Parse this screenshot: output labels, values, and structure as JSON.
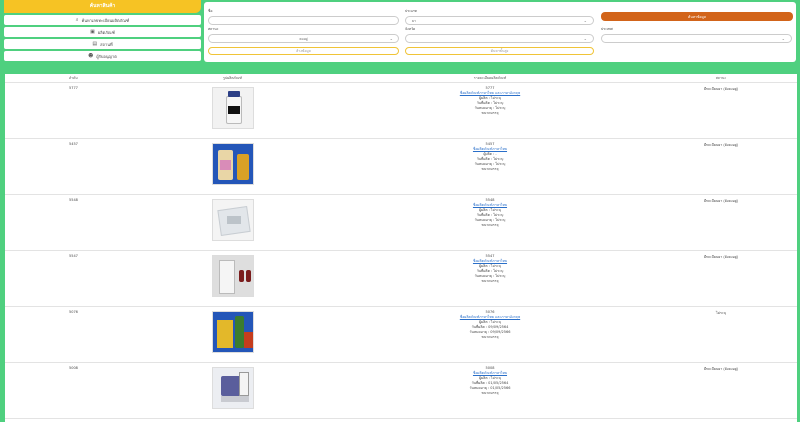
{
  "sidebar": {
    "header": "ค้นหาสินค้า",
    "items": [
      {
        "label": "ค้นหาเลขทะเบียนผลิตภัณฑ์",
        "icon": "search-icon"
      },
      {
        "label": "ผลิตภัณฑ์",
        "icon": "box-icon"
      },
      {
        "label": "สถานที่",
        "icon": "building-icon"
      },
      {
        "label": "ผู้รับอนุญาต",
        "icon": "user-icon"
      }
    ]
  },
  "search": {
    "name_label": "ชื่อ",
    "name_value": "",
    "type_label": "ประเภท",
    "type_value": "ยา",
    "search_button": "ค้นหาข้อมูล",
    "status_label": "สถานะ",
    "status_value": "คงอยู่",
    "province_label": "จังหวัด",
    "province_value": "",
    "country_label": "ประเทศ",
    "country_value": "",
    "clear_button": "ล้างข้อมูล",
    "advanced_button": "ค้นหาขั้นสูง"
  },
  "table": {
    "headers": [
      "ลำดับ",
      "รูปผลิตภัณฑ์",
      "รายละเอียดผลิตภัณฑ์",
      "สถานะ"
    ],
    "rows": [
      {
        "id": "5777",
        "code": "5777",
        "name": "ชื่อผลิตภัณฑ์ภาษาไทย และภาษาอังกฤษ",
        "line1": "ผู้ผลิต : ไม่ระบุ",
        "line2": "วันที่ผลิต : ไม่ระบุ",
        "line3": "วันหมดอายุ : ไม่ระบุ",
        "line4": "ขนาดบรรจุ",
        "status": "มีทะเบียนยา (ยังคงอยู่)"
      },
      {
        "id": "5457",
        "code": "5457",
        "name": "ชื่อผลิตภัณฑ์ภาษาไทย",
        "line1": "ผู้ผลิต : -",
        "line2": "วันที่ผลิต : ไม่ระบุ",
        "line3": "วันหมดอายุ : ไม่ระบุ",
        "line4": "ขนาดบรรจุ",
        "status": "มีทะเบียนยา (ยังคงอยู่)"
      },
      {
        "id": "5548",
        "code": "5548",
        "name": "ชื่อผลิตภัณฑ์ภาษาไทย",
        "line1": "ผู้ผลิต : ไม่ระบุ",
        "line2": "วันที่ผลิต : ไม่ระบุ",
        "line3": "วันหมดอายุ : ไม่ระบุ",
        "line4": "ขนาดบรรจุ",
        "status": "มีทะเบียนยา (ยังคงอยู่)"
      },
      {
        "id": "5547",
        "code": "5547",
        "name": "ชื่อผลิตภัณฑ์ภาษาไทย",
        "line1": "ผู้ผลิต : ไม่ระบุ",
        "line2": "วันที่ผลิต : ไม่ระบุ",
        "line3": "วันหมดอายุ : ไม่ระบุ",
        "line4": "ขนาดบรรจุ",
        "status": "มีทะเบียนยา (ยังคงอยู่)"
      },
      {
        "id": "5076",
        "code": "5076",
        "name": "ชื่อผลิตภัณฑ์ภาษาไทย และภาษาอังกฤษ",
        "line1": "ผู้ผลิต : ไม่ระบุ",
        "line2": "วันที่ผลิต : 09/09/2564",
        "line3": "วันหมดอายุ : 09/09/2566",
        "line4": "ขนาดบรรจุ",
        "status": "ไม่ระบุ"
      },
      {
        "id": "5008",
        "code": "5008",
        "name": "ชื่อผลิตภัณฑ์ภาษาไทย",
        "line1": "ผู้ผลิต : ไม่ระบุ",
        "line2": "วันที่ผลิต : 01/05/2564",
        "line3": "วันหมดอายุ : 01/05/2566",
        "line4": "ขนาดบรรจุ",
        "status": "มีทะเบียนยา (ยังคงอยู่)"
      }
    ]
  }
}
